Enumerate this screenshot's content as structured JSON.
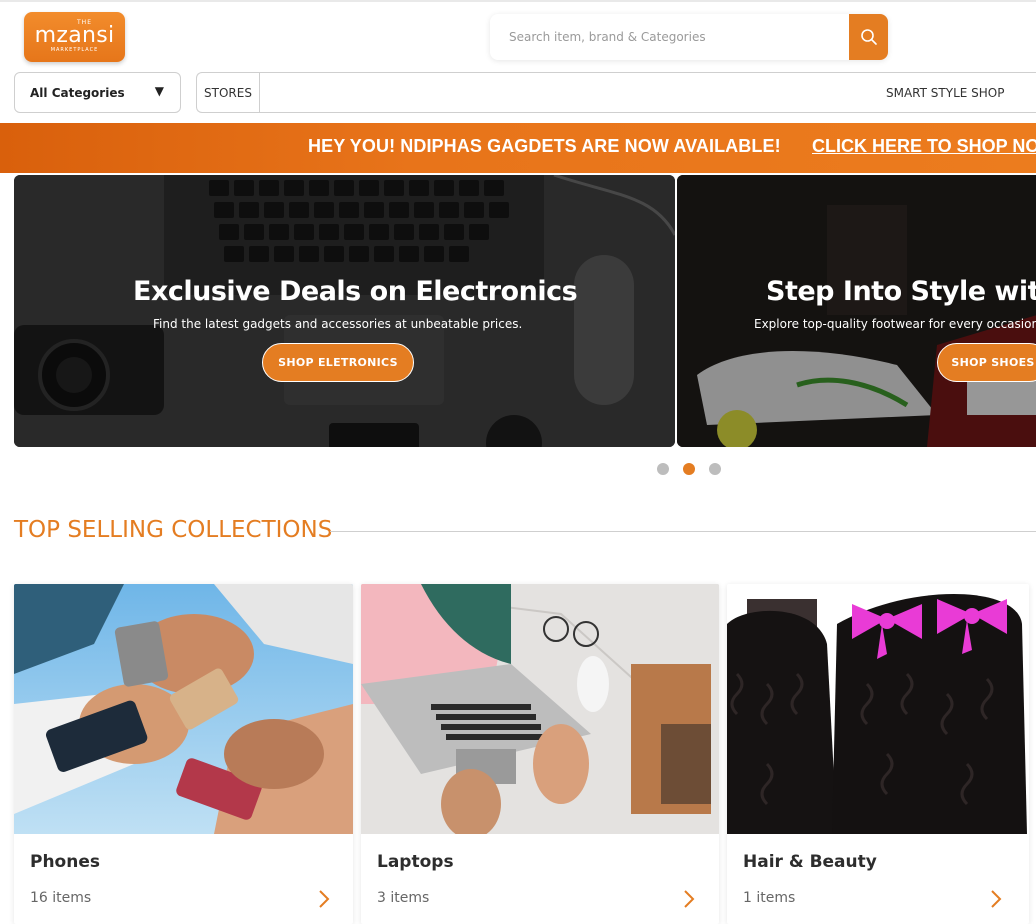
{
  "header": {
    "logo": {
      "the": "THE",
      "brand": "mzansi",
      "sub": "MARKETPLACE"
    },
    "search": {
      "placeholder": "Search item, brand & Categories",
      "icon": "search-icon"
    }
  },
  "nav": {
    "category_select": {
      "selected": "All Categories",
      "arrow": "▼"
    },
    "links": [
      {
        "label": "STORES"
      },
      {
        "label": "SMART STYLE SHOP"
      }
    ]
  },
  "promo": {
    "text": "HEY YOU! NDIPHAS GAGDETS ARE NOW AVAILABLE!",
    "link": "CLICK HERE TO SHOP NOW"
  },
  "hero": {
    "slides": [
      {
        "title": "Exclusive Deals on Electronics",
        "subtitle": "Find the latest gadgets and accessories at unbeatable prices.",
        "button": "SHOP ELETRONICS"
      },
      {
        "title": "Step Into Style with Shoes",
        "subtitle": "Explore top-quality footwear for every occasion.",
        "button": "SHOP SHOES"
      }
    ],
    "dots": 3,
    "active_dot": 1
  },
  "section": {
    "title": "TOP SELLING COLLECTIONS"
  },
  "collections": [
    {
      "name": "Phones",
      "count": "16 items"
    },
    {
      "name": "Laptops",
      "count": "3 items"
    },
    {
      "name": "Hair & Beauty",
      "count": "1 items"
    }
  ],
  "colors": {
    "accent": "#e47d22",
    "dot_inactive": "#bdbdbd"
  }
}
